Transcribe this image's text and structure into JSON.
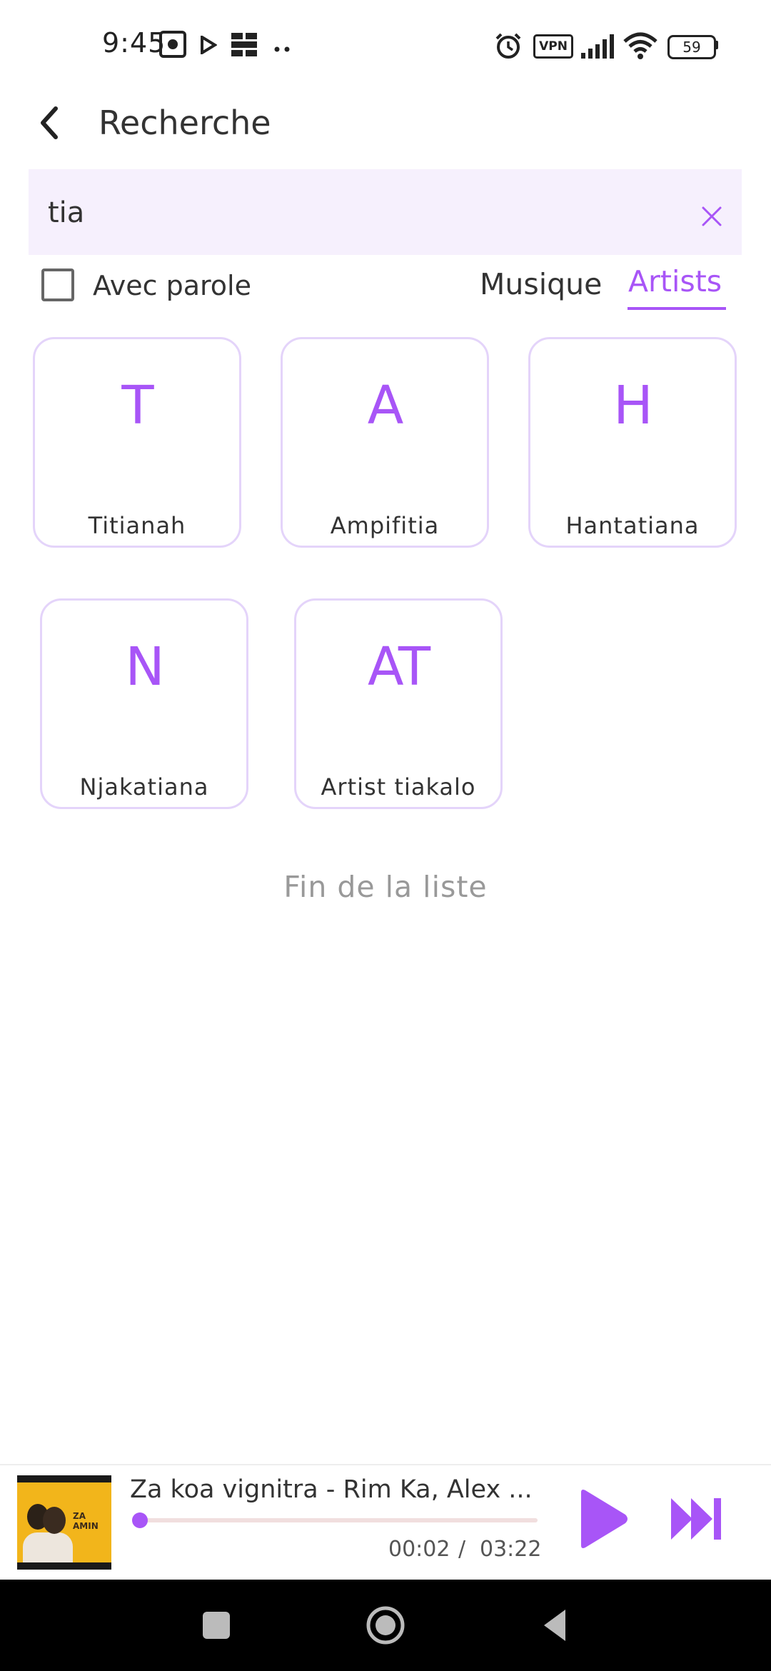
{
  "status_bar": {
    "time": "9:45",
    "vpn": "VPN",
    "battery": "59",
    "icons": [
      "screenshot-icon",
      "play-store-icon",
      "grid-icon",
      "more-dots-icon",
      "alarm-icon",
      "vpn-icon",
      "signal-icon",
      "wifi-icon",
      "battery-icon"
    ]
  },
  "header": {
    "title": "Recherche",
    "back_icon": "back-arrow-icon"
  },
  "search": {
    "value": "tia",
    "clear_icon": "close-icon"
  },
  "filters": {
    "checkbox_label": "Avec parole",
    "checkbox_checked": false,
    "tabs": [
      {
        "label": "Musique",
        "active": false
      },
      {
        "label": "Artists",
        "active": true
      }
    ]
  },
  "artists": [
    {
      "initials": "T",
      "name": "Titianah"
    },
    {
      "initials": "A",
      "name": "Ampifitia"
    },
    {
      "initials": "H",
      "name": "Hantatiana"
    },
    {
      "initials": "N",
      "name": "Njakatiana"
    },
    {
      "initials": "AT",
      "name": "Artist tiakalo"
    }
  ],
  "end_of_list": "Fin de la liste",
  "player": {
    "title": "Za koa vignitra - Rim Ka, Alex ...",
    "current_time": "00:02",
    "separator": "/",
    "total_time": "03:22",
    "progress": 0.01,
    "art_text": "ZA AMIN",
    "play_icon": "play-icon",
    "skip_icon": "skip-next-icon"
  },
  "colors": {
    "accent": "#a855f7",
    "search_bg": "#f6f0fd",
    "card_border": "#e4d4fa",
    "muted": "#999999"
  }
}
